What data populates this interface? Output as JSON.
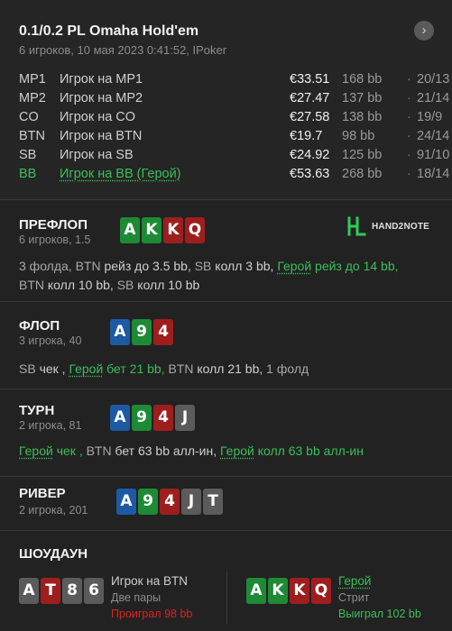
{
  "header": {
    "title": "0.1/0.2 PL Omaha Hold'em",
    "subtitle": "6 игроков, 10 мая 2023 0:41:52, IPoker",
    "nav_icon": "chevron-right-icon",
    "nav_glyph": "›"
  },
  "players": [
    {
      "pos": "MP1",
      "name": "Игрок на MP1",
      "stack": "€33.51",
      "bb": "168 bb",
      "sep": "·",
      "cards": "20/13",
      "hero": false
    },
    {
      "pos": "MP2",
      "name": "Игрок на MP2",
      "stack": "€27.47",
      "bb": "137 bb",
      "sep": "·",
      "cards": "21/14",
      "hero": false
    },
    {
      "pos": "CO",
      "name": "Игрок на CO",
      "stack": "€27.58",
      "bb": "138 bb",
      "sep": "·",
      "cards": "19/9",
      "hero": false
    },
    {
      "pos": "BTN",
      "name": "Игрок на BTN",
      "stack": "€19.7",
      "bb": "98 bb",
      "sep": "·",
      "cards": "24/14",
      "hero": false
    },
    {
      "pos": "SB",
      "name": "Игрок на SB",
      "stack": "€24.92",
      "bb": "125 bb",
      "sep": "·",
      "cards": "91/10",
      "hero": false
    },
    {
      "pos": "BB",
      "name": "Игрок на BB (Герой)",
      "stack": "€53.63",
      "bb": "268 bb",
      "sep": "·",
      "cards": "18/14",
      "hero": true
    }
  ],
  "colors": {
    "red": "#9e1e1e",
    "green": "#1e8a36",
    "blue": "#1d5aa3",
    "gray": "#5b5b5b",
    "hero": "#3bbf5a",
    "lost": "#e02020"
  },
  "brand": {
    "name": "HAND2NOTE",
    "icon": "hand2note-logo-icon"
  },
  "streets": {
    "preflop": {
      "name": "ПРЕФЛОП",
      "sub": "6 игроков, 1.5",
      "cards": [
        {
          "r": "A",
          "c": "green"
        },
        {
          "r": "K",
          "c": "green"
        },
        {
          "r": "K",
          "c": "red"
        },
        {
          "r": "Q",
          "c": "red"
        }
      ],
      "action_line1": [
        {
          "t": "3 фолда, ",
          "k": "muted"
        },
        {
          "t": "BTN ",
          "k": "muted"
        },
        {
          "t": "рейз до 3.5 bb, ",
          "k": "plain"
        },
        {
          "t": "SB ",
          "k": "muted"
        },
        {
          "t": "колл 3 bb, ",
          "k": "plain"
        },
        {
          "t": "Герой",
          "k": "hero-under"
        },
        {
          "t": " рейз до 14 bb,",
          "k": "hero"
        }
      ],
      "action_line2": [
        {
          "t": "BTN ",
          "k": "muted"
        },
        {
          "t": "колл 10 bb, ",
          "k": "plain"
        },
        {
          "t": "SB ",
          "k": "muted"
        },
        {
          "t": "колл 10 bb",
          "k": "plain"
        }
      ]
    },
    "flop": {
      "name": "ФЛОП",
      "sub": "3 игрока, 40",
      "cards": [
        {
          "r": "A",
          "c": "blue"
        },
        {
          "r": "9",
          "c": "green"
        },
        {
          "r": "4",
          "c": "red"
        }
      ],
      "action": [
        {
          "t": "SB ",
          "k": "muted"
        },
        {
          "t": "чек , ",
          "k": "plain"
        },
        {
          "t": "Герой",
          "k": "hero-under"
        },
        {
          "t": " бет 21 bb, ",
          "k": "hero"
        },
        {
          "t": "BTN ",
          "k": "muted"
        },
        {
          "t": "колл 21 bb, ",
          "k": "plain"
        },
        {
          "t": "1 фолд",
          "k": "muted"
        }
      ]
    },
    "turn": {
      "name": "ТУРН",
      "sub": "2 игрока, 81",
      "cards": [
        {
          "r": "A",
          "c": "blue"
        },
        {
          "r": "9",
          "c": "green"
        },
        {
          "r": "4",
          "c": "red"
        },
        {
          "r": "J",
          "c": "gray"
        }
      ],
      "action": [
        {
          "t": "Герой",
          "k": "hero-under"
        },
        {
          "t": " чек , ",
          "k": "hero"
        },
        {
          "t": "BTN ",
          "k": "muted"
        },
        {
          "t": "бет 63 bb алл-ин, ",
          "k": "plain"
        },
        {
          "t": "Герой",
          "k": "hero-under"
        },
        {
          "t": " колл 63 bb алл-ин",
          "k": "hero"
        }
      ]
    },
    "river": {
      "name": "РИВЕР",
      "sub": "2 игрока, 201",
      "cards": [
        {
          "r": "A",
          "c": "blue"
        },
        {
          "r": "9",
          "c": "green"
        },
        {
          "r": "4",
          "c": "red"
        },
        {
          "r": "J",
          "c": "gray"
        },
        {
          "r": "T",
          "c": "gray"
        }
      ]
    }
  },
  "showdown": {
    "title": "ШОУДАУН",
    "left": {
      "cards": [
        {
          "r": "A",
          "c": "gray"
        },
        {
          "r": "T",
          "c": "red"
        },
        {
          "r": "8",
          "c": "gray"
        },
        {
          "r": "6",
          "c": "gray"
        }
      ],
      "name": "Игрок на BTN",
      "hand": "Две пары",
      "result": "Проиграл 98 bb"
    },
    "right": {
      "cards": [
        {
          "r": "A",
          "c": "green"
        },
        {
          "r": "K",
          "c": "green"
        },
        {
          "r": "K",
          "c": "red"
        },
        {
          "r": "Q",
          "c": "red"
        }
      ],
      "name": "Герой",
      "hand": "Стрит",
      "result": "Выиграл 102 bb"
    }
  }
}
